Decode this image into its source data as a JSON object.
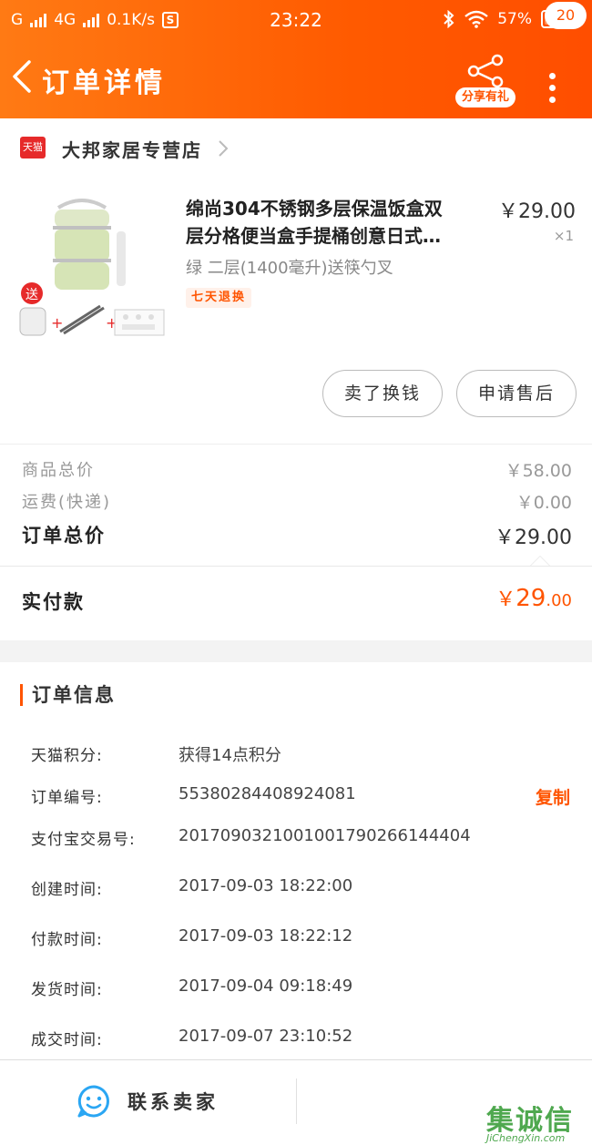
{
  "status_bar": {
    "carrier_left": "G",
    "network": "4G",
    "speed": "0.1K/s",
    "s_badge": "S",
    "time": "23:22",
    "battery_percent": "57%",
    "battery_level": 0.57
  },
  "header": {
    "title": "订单详情",
    "share_label": "分享有礼",
    "badge_count": "20"
  },
  "store": {
    "logo_text": "天猫",
    "name": "大邦家居专营店"
  },
  "product": {
    "name_line1": "绵尚304不锈钢多层保温饭盒双",
    "name_line2": "层分格便当盒手提桶创意日式…",
    "price": "￥29.00",
    "quantity": "×1",
    "sku": "绿 二层(1400毫升)送筷勺叉",
    "tag": "七天退换",
    "image_gift_label": "送"
  },
  "actions": {
    "sell_label": "卖了换钱",
    "after_sale_label": "申请售后"
  },
  "summary": {
    "goods_total_label": "商品总价",
    "goods_total_value": "￥58.00",
    "shipping_label": "运费(快递)",
    "shipping_value": "￥0.00",
    "order_total_label": "订单总价",
    "order_total_value": "￥29.00",
    "paid_label": "实付款",
    "paid_currency": "￥",
    "paid_int": "29",
    "paid_dec": ".00"
  },
  "order_info": {
    "title": "订单信息",
    "rows": [
      {
        "label": "天猫积分:",
        "value": "获得14点积分"
      },
      {
        "label": "订单编号:",
        "value": "55380284408924081"
      },
      {
        "label": "支付宝交易号:",
        "value": "2017090321001001790266144404"
      },
      {
        "label": "创建时间:",
        "value": "2017-09-03 18:22:00"
      },
      {
        "label": "付款时间:",
        "value": "2017-09-03 18:22:12"
      },
      {
        "label": "发货时间:",
        "value": "2017-09-04 09:18:49"
      },
      {
        "label": "成交时间:",
        "value": "2017-09-07 23:10:52"
      }
    ],
    "copy_label": "复制"
  },
  "bottom_bar": {
    "contact_label": "联系卖家"
  },
  "watermark": {
    "text": "集诚信",
    "url": "JiChengXin.com"
  },
  "colors": {
    "accent": "#ff5400",
    "header_gradient_start": "#ff7a14",
    "tmall_red": "#e62a2a",
    "chat_blue": "#2aa6f3",
    "watermark_green": "#4fa84f"
  },
  "icons": [
    "back-chevron-icon",
    "share-icon",
    "more-dots-icon",
    "tmall-logo-icon",
    "chevron-right-icon",
    "chat-smile-icon",
    "wifi-icon",
    "bluetooth-icon",
    "battery-icon",
    "signal-icon"
  ]
}
